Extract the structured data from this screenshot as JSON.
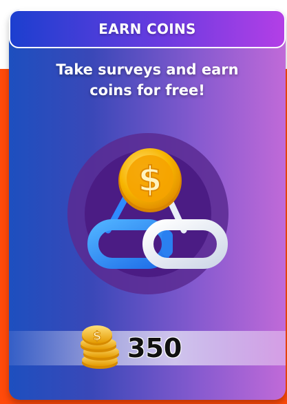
{
  "header": {
    "title": "EARN COINS"
  },
  "main": {
    "subtitle": "Take surveys and earn coins for free!",
    "illustration_icon": "linked-chain-with-dollar-coin-icon"
  },
  "balance": {
    "icon": "coin-stack-icon",
    "value": "350"
  },
  "colors": {
    "background_accent": "#ff4a0a",
    "card_gradient_start": "#1d4fbf",
    "card_gradient_end": "#c06ad8",
    "header_gradient_start": "#1c3fcf",
    "header_gradient_end": "#b33fe6",
    "coin_gold": "#f5b700"
  }
}
